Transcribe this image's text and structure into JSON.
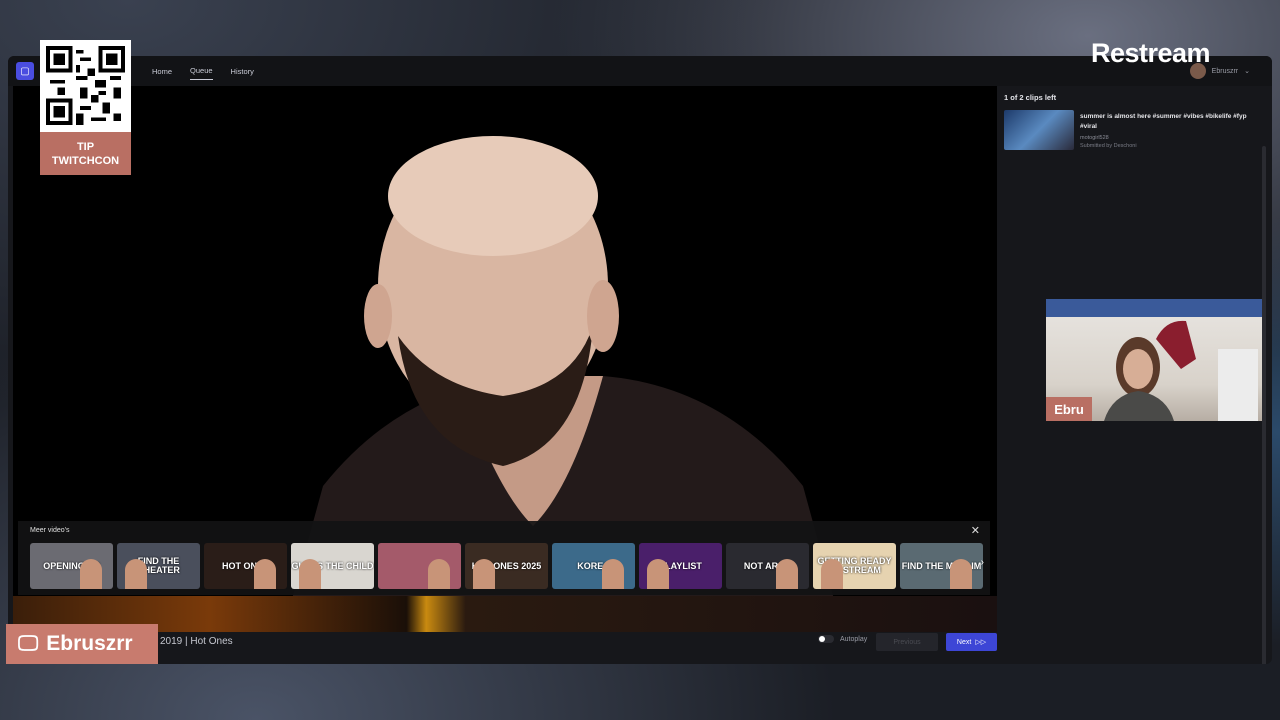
{
  "nav": {
    "home": "Home",
    "queue": "Queue",
    "history": "History"
  },
  "user": {
    "name": "Ebruszrr"
  },
  "overlay": {
    "tip_line1": "TIP",
    "tip_line2": "TWITCHCON",
    "brand": "Restream",
    "cam_name": "Ebru",
    "handle": "Ebruszrr"
  },
  "queue": {
    "count": "1 of 2 clips left",
    "clip": {
      "title": "summer is almost here #summer #vibes #bikelife #fyp #viral",
      "uploader": "motogirl528",
      "submitted": "Submitted by Deschoni"
    }
  },
  "more_videos": {
    "label": "Meer video's",
    "items": [
      {
        "text": "OPENING UP",
        "color": "#6b6b72"
      },
      {
        "text": "FIND THE CHEATER",
        "color": "#4a4f5c"
      },
      {
        "text": "HOT ONES",
        "color": "#2a1d18"
      },
      {
        "text": "GUESS THE CHILD",
        "color": "#d9d6d0"
      },
      {
        "text": "",
        "color": "#a45a6a"
      },
      {
        "text": "HOT ONES 2025",
        "color": "#3a2b22"
      },
      {
        "text": "KOREA",
        "color": "#3c6a8a"
      },
      {
        "text": "PLAYLIST",
        "color": "#4a1f6a"
      },
      {
        "text": "NOT ARAB",
        "color": "#2a2a30"
      },
      {
        "text": "GETTING READY TO STREAM",
        "color": "#e6d3b0"
      },
      {
        "text": "FIND THE MUSLIM",
        "color": "#5a6a72"
      }
    ]
  },
  "video": {
    "title": "2019 | Hot Ones",
    "autoplay": "Autoplay",
    "previous": "Previous",
    "next": "Next"
  }
}
